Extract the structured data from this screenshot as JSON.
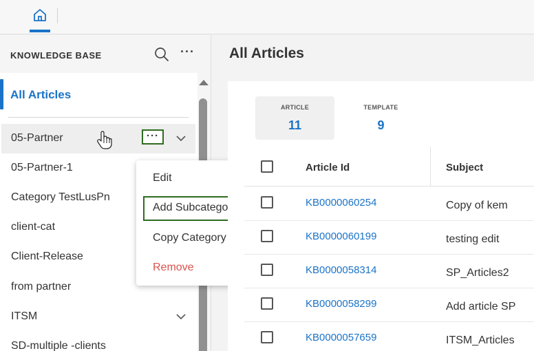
{
  "sidebar": {
    "title": "KNOWLEDGE BASE",
    "all_articles": "All Articles",
    "categories": [
      {
        "label": "05-Partner",
        "has_children": true,
        "selected": true
      },
      {
        "label": "05-Partner-1"
      },
      {
        "label": "Category TestLusPn"
      },
      {
        "label": "client-cat"
      },
      {
        "label": "Client-Release"
      },
      {
        "label": "from partner"
      },
      {
        "label": "ITSM",
        "has_children": true
      },
      {
        "label": "SD-multiple -clients"
      }
    ],
    "more_button_label": "···"
  },
  "context_menu": {
    "items": [
      {
        "label": "Edit"
      },
      {
        "label": "Add Subcategory",
        "highlighted": true
      },
      {
        "label": "Copy Category Id"
      },
      {
        "label": "Remove",
        "danger": true
      }
    ]
  },
  "main": {
    "title": "All Articles",
    "stats": [
      {
        "label": "ARTICLE",
        "value": "11",
        "active": true
      },
      {
        "label": "TEMPLATE",
        "value": "9",
        "active": false
      }
    ],
    "table": {
      "columns": [
        "Article Id",
        "Subject"
      ],
      "rows": [
        {
          "id": "KB0000060254",
          "subject": "Copy of kem"
        },
        {
          "id": "KB0000060199",
          "subject": "testing edit"
        },
        {
          "id": "KB0000058314",
          "subject": "SP_Articles2"
        },
        {
          "id": "KB0000058299",
          "subject": "Add article SP"
        },
        {
          "id": "KB0000057659",
          "subject": "ITSM_Articles"
        }
      ]
    }
  },
  "colors": {
    "accent": "#1a73c8",
    "highlight_border": "#2e6b1f",
    "danger": "#d9534f"
  }
}
